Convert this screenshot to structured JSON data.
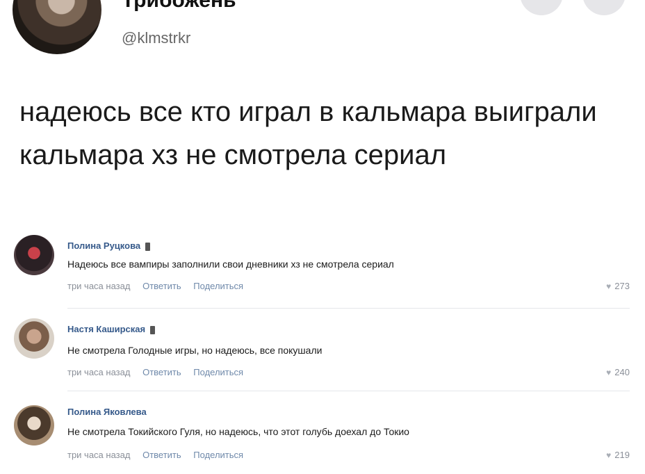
{
  "post": {
    "author_name": "Трибожень",
    "author_handle": "@klmstrkr",
    "text": "надеюсь все кто играл в кальмара выиграли кальмара хз не смотрела сериал"
  },
  "comments": [
    {
      "name": "Полина Руцкова",
      "text": "Надеюсь все вампиры заполнили свои дневники хз не смотрела сериал",
      "time": "три часа назад",
      "reply": "Ответить",
      "share": "Поделиться",
      "likes": "273"
    },
    {
      "name": "Настя Каширская",
      "text": "Не смотрела Голодные игры, но надеюсь, все покушали",
      "time": "три часа назад",
      "reply": "Ответить",
      "share": "Поделиться",
      "likes": "240"
    },
    {
      "name": "Полина Яковлева",
      "text": "Не смотрела Токийского Гуля, но надеюсь, что этот голубь доехал до Токио",
      "time": "три часа назад",
      "reply": "Ответить",
      "share": "Поделиться",
      "likes": "219"
    }
  ],
  "icons": {
    "like": "heart-icon",
    "badge": "phone-badge-icon"
  }
}
